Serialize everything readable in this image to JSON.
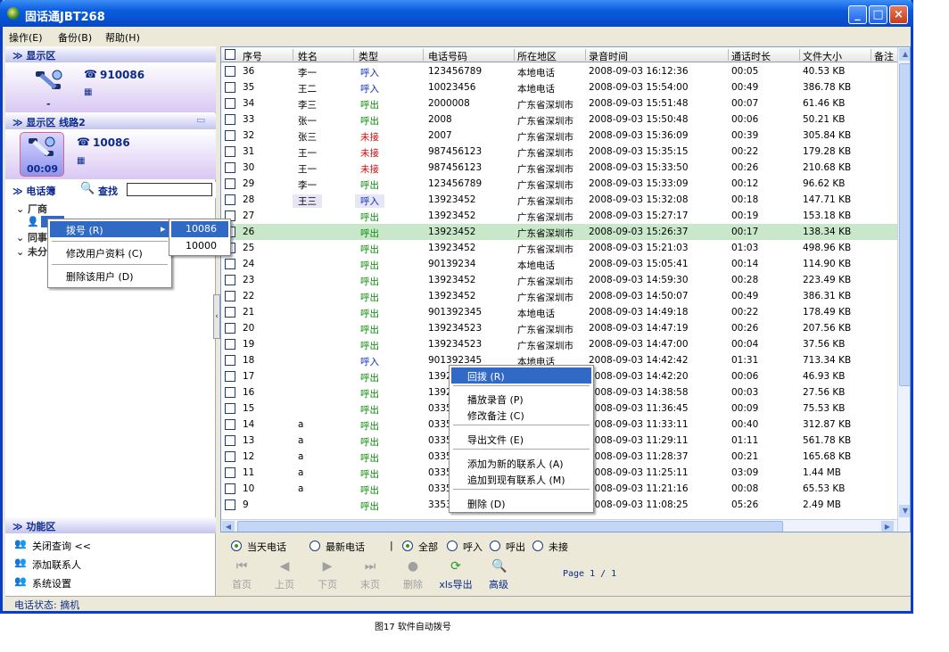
{
  "window": {
    "title": "固话通JBT268"
  },
  "menu": [
    {
      "label": "操作(E)"
    },
    {
      "label": "备份(B)"
    },
    {
      "label": "帮助(H)"
    }
  ],
  "left": {
    "display1": {
      "header": "≫ 显示区",
      "number": "910086",
      "time": "-"
    },
    "display2": {
      "header": "≫ 显示区  线路2",
      "number": "10086",
      "time": "00:09"
    },
    "phonebook": {
      "header": "≫ 电话簿",
      "search_label": "查找",
      "search_value": "",
      "groups": [
        "厂商",
        "同事",
        "未分"
      ]
    },
    "func": {
      "header": "≫ 功能区",
      "items": [
        "关闭查询  <<",
        "添加联系人",
        "系统设置"
      ]
    }
  },
  "left_ctx": {
    "items": [
      "拨号 (R)",
      "修改用户资料   (C)",
      "删除该用户  (D)"
    ],
    "submenu": [
      "10086",
      "10000"
    ]
  },
  "grid": {
    "columns": [
      "序号",
      "姓名",
      "类型",
      "电话号码",
      "所在地区",
      "录音时间",
      "通话时长",
      "文件大小",
      "备注"
    ],
    "rows": [
      [
        "36",
        "李一",
        "呼入",
        "123456789",
        "本地电话",
        "2008-09-03 16:12:36",
        "00:05",
        "40.53 KB"
      ],
      [
        "35",
        "王二",
        "呼入",
        "10023456",
        "本地电话",
        "2008-09-03 15:54:00",
        "00:49",
        "386.78 KB"
      ],
      [
        "34",
        "李三",
        "呼出",
        "2000008",
        "广东省深圳市",
        "2008-09-03 15:51:48",
        "00:07",
        "61.46 KB"
      ],
      [
        "33",
        "张一",
        "呼出",
        "2008",
        "广东省深圳市",
        "2008-09-03 15:50:48",
        "00:06",
        "50.21 KB"
      ],
      [
        "32",
        "张三",
        "未接",
        "2007",
        "广东省深圳市",
        "2008-09-03 15:36:09",
        "00:39",
        "305.84 KB"
      ],
      [
        "31",
        "王一",
        "未接",
        "987456123",
        "广东省深圳市",
        "2008-09-03 15:35:15",
        "00:22",
        "179.28 KB"
      ],
      [
        "30",
        "王一",
        "未接",
        "987456123",
        "广东省深圳市",
        "2008-09-03 15:33:50",
        "00:26",
        "210.68 KB"
      ],
      [
        "29",
        "李一",
        "呼出",
        "123456789",
        "广东省深圳市",
        "2008-09-03 15:33:09",
        "00:12",
        "96.62 KB"
      ],
      [
        "28",
        "王三",
        "呼入",
        "13923452",
        "广东省深圳市",
        "2008-09-03 15:32:08",
        "00:18",
        "147.71 KB"
      ],
      [
        "27",
        "",
        "呼出",
        "13923452",
        "广东省深圳市",
        "2008-09-03 15:27:17",
        "00:19",
        "153.18 KB"
      ],
      [
        "26",
        "",
        "呼出",
        "13923452",
        "广东省深圳市",
        "2008-09-03 15:26:37",
        "00:17",
        "138.34 KB"
      ],
      [
        "25",
        "",
        "呼出",
        "13923452",
        "广东省深圳市",
        "2008-09-03 15:21:03",
        "01:03",
        "498.96 KB"
      ],
      [
        "24",
        "",
        "呼出",
        "90139234",
        "本地电话",
        "2008-09-03 15:05:41",
        "00:14",
        "114.90 KB"
      ],
      [
        "23",
        "",
        "呼出",
        "13923452",
        "广东省深圳市",
        "2008-09-03 14:59:30",
        "00:28",
        "223.49 KB"
      ],
      [
        "22",
        "",
        "呼出",
        "13923452",
        "广东省深圳市",
        "2008-09-03 14:50:07",
        "00:49",
        "386.31 KB"
      ],
      [
        "21",
        "",
        "呼出",
        "901392345",
        "本地电话",
        "2008-09-03 14:49:18",
        "00:22",
        "178.49 KB"
      ],
      [
        "20",
        "",
        "呼出",
        "139234523",
        "广东省深圳市",
        "2008-09-03 14:47:19",
        "00:26",
        "207.56 KB"
      ],
      [
        "19",
        "",
        "呼出",
        "139234523",
        "广东省深圳市",
        "2008-09-03 14:47:00",
        "00:04",
        "37.56 KB"
      ],
      [
        "18",
        "",
        "呼入",
        "901392345",
        "本地电话",
        "2008-09-03 14:42:42",
        "01:31",
        "713.34 KB"
      ],
      [
        "17",
        "",
        "呼出",
        "1392",
        "",
        "2008-09-03 14:42:20",
        "00:06",
        "46.93 KB"
      ],
      [
        "16",
        "",
        "呼出",
        "1392",
        "",
        "2008-09-03 14:38:58",
        "00:03",
        "27.56 KB"
      ],
      [
        "15",
        "",
        "呼出",
        "0335",
        "",
        "2008-09-03 11:36:45",
        "00:09",
        "75.53 KB"
      ],
      [
        "14",
        "a",
        "呼出",
        "0335",
        "",
        "2008-09-03 11:33:11",
        "00:40",
        "312.87 KB"
      ],
      [
        "13",
        "a",
        "呼出",
        "0335",
        "",
        "2008-09-03 11:29:11",
        "01:11",
        "561.78 KB"
      ],
      [
        "12",
        "a",
        "呼出",
        "0335",
        "",
        "2008-09-03 11:28:37",
        "00:21",
        "165.68 KB"
      ],
      [
        "11",
        "a",
        "呼出",
        "0335",
        "",
        "2008-09-03 11:25:11",
        "03:09",
        "1.44 MB"
      ],
      [
        "10",
        "a",
        "呼出",
        "0335",
        "",
        "2008-09-03 11:21:16",
        "00:08",
        "65.53 KB"
      ],
      [
        "9",
        "",
        "呼出",
        "3353",
        "",
        "2008-09-03 11:08:25",
        "05:26",
        "2.49 MB"
      ]
    ]
  },
  "grid_ctx": {
    "items": [
      "回拨 (R)",
      "播放录音 (P)",
      "修改备注 (C)",
      "导出文件 (E)",
      "添加为新的联系人  (A)",
      "追加到现有联系人  (M)",
      "删除 (D)"
    ]
  },
  "filters": {
    "period": [
      "当天电话",
      "最新电话"
    ],
    "types": [
      "全部",
      "呼入",
      "呼出",
      "未接"
    ],
    "divider": "|"
  },
  "nav": [
    "首页",
    "上页",
    "下页",
    "末页",
    "删除",
    "xls导出",
    "高级"
  ],
  "page": "Page 1 / 1",
  "status": "电话状态:  摘机",
  "caption": "图17 软件自动拨号"
}
